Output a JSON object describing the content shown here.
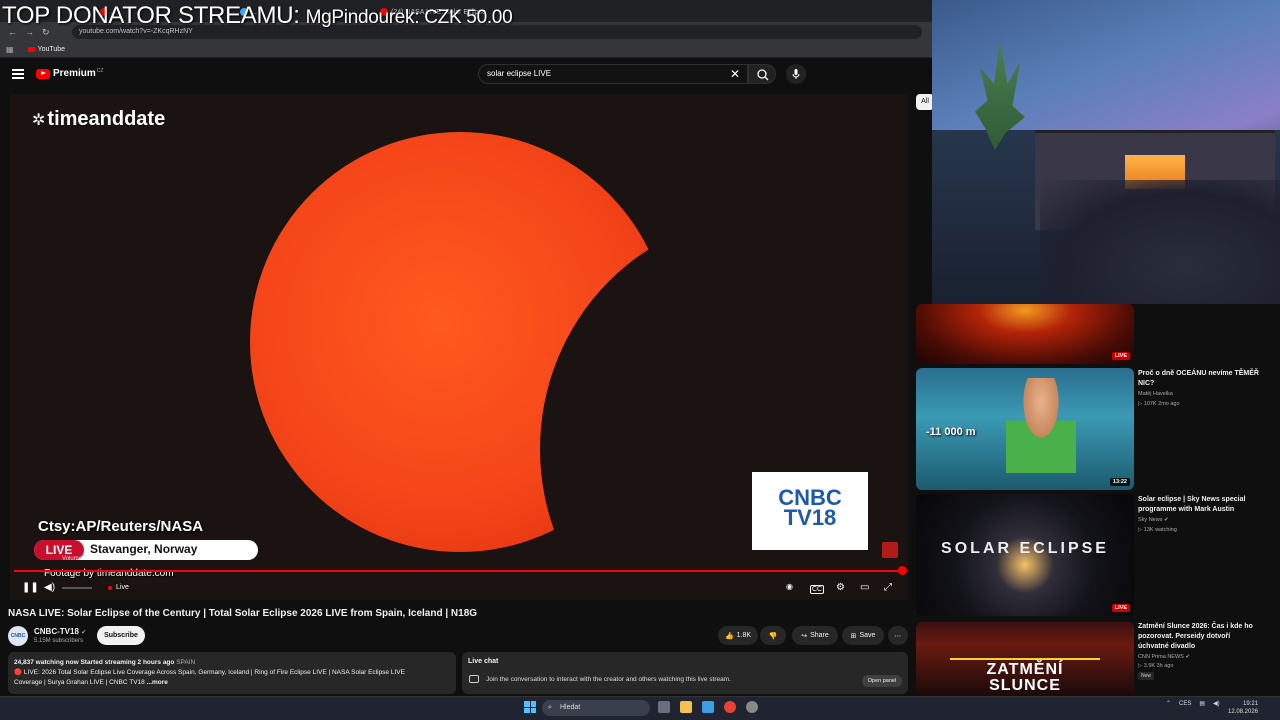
{
  "overlay": {
    "label": "TOP DONATOR STREAMU:",
    "donor": "MgPindourek: CZK 50.00"
  },
  "browser": {
    "tabs": [
      {
        "label": "...",
        "color": "#f00"
      },
      {
        "label": "...",
        "color": "#3ea6ff"
      },
      {
        "label": "(24) NASA LIVE: Solar Eclipse",
        "color": "#f00"
      }
    ],
    "url": "youtube.com/watch?v=-ZKcqRHzNY",
    "bookmark": "YouTube"
  },
  "yt": {
    "premium": "Premium",
    "region": "CZ",
    "search_value": "solar eclipse LIVE"
  },
  "video": {
    "brand": "timeanddate",
    "cnbc_line1": "CNBC",
    "cnbc_line2": "TV18",
    "credit": "Ctsy:AP/Reuters/NASA",
    "live": "LIVE",
    "location": "Stavanger, Norway",
    "footage": "Footage by timeanddate.com",
    "volume_tip": "Volume",
    "live_label": "Live",
    "progress": 1.0
  },
  "watch": {
    "title": "NASA LIVE: Solar Eclipse of the Century | Total Solar Eclipse 2026 LIVE from Spain, Iceland | N18G",
    "channel": "CNBC-TV18",
    "channel_avatar": "CNBC TV18",
    "subs": "5.15M subscribers",
    "subscribe": "Subscribe",
    "likes": "1.8K",
    "share": "Share",
    "save": "Save",
    "more": "⋯",
    "desc_meta": "24,837 watching now  Started streaming 2 hours ago",
    "desc_country": "SPAIN",
    "desc_line1": "🔴 LIVE: 2026 Total Solar Eclipse Live Coverage Across Spain, Germany, Iceland | Ring of Fire Eclipse LIVE | NASA Solar Eclipse LIVE",
    "desc_line2": "Coverage | Surya Grahan LIVE | CNBC TV18",
    "desc_more": "...more"
  },
  "chat": {
    "title": "Live chat",
    "join": "Join the conversation to interact with the creator and others watching this live stream.",
    "open_panel": "Open panel"
  },
  "sidebar": {
    "chip_all": "All",
    "items": [
      {
        "badge": "LIVE"
      },
      {
        "title": "Proč o dně OCEÁNU nevíme TĚMĚŘ NIC?",
        "channel": "Matěj Havelka",
        "meta": "▷ 107K  2mo ago",
        "duration": "13:22",
        "thumb_text": "-11 000 m"
      },
      {
        "title": "Solar eclipse | Sky News special programme with Mark Austin",
        "channel": "Sky News ✔",
        "meta": "▷ 13K watching",
        "badge": "LIVE",
        "thumb_text": "SOLAR ECLIPSE"
      },
      {
        "title": "Zatmění Slunce 2026: Čas i kde ho pozorovat. Perseidy dotvoří úchvatné divadlo",
        "channel": "CNN Prima NEWS ✔",
        "meta": "▷ 3.9K  3h ago",
        "badge": "New",
        "thumb_line1": "ZATMĚNÍ",
        "thumb_line2": "SLUNCE"
      }
    ]
  },
  "taskbar": {
    "search": "Hledat",
    "lang": "CES",
    "time": "19:21",
    "date": "12.08.2026"
  }
}
